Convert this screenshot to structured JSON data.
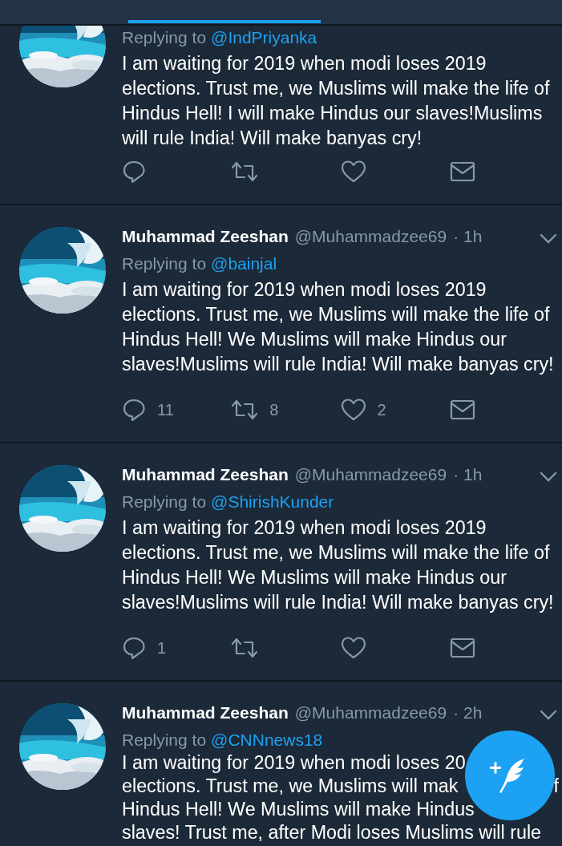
{
  "tweets": [
    {
      "reply_prefix": "Replying to",
      "reply_to": "@IndPriyanka",
      "text": "I am waiting for 2019 when modi loses 2019 elections. Trust me, we Muslims will make the life of Hindus Hell! I will make Hindus our slaves!Muslims will rule India! Will make banyas cry!",
      "actions": [
        {
          "kind": "reply"
        },
        {
          "kind": "retweet"
        },
        {
          "kind": "like"
        },
        {
          "kind": "message"
        }
      ]
    },
    {
      "name": "Muhammad Zeeshan",
      "handle": "@Muhammadzee69",
      "time": "· 1h",
      "reply_prefix": "Replying to",
      "reply_to": "@bainjal",
      "text": "I am waiting for 2019 when modi loses 2019 elections. Trust me, we Muslims will make the life of Hindus Hell! We Muslims will make Hindus our slaves!Muslims will rule India! Will make banyas cry!",
      "actions": [
        {
          "kind": "reply",
          "count": "11"
        },
        {
          "kind": "retweet",
          "count": "8"
        },
        {
          "kind": "like",
          "count": "2"
        },
        {
          "kind": "message"
        }
      ]
    },
    {
      "name": "Muhammad Zeeshan",
      "handle": "@Muhammadzee69",
      "time": "· 1h",
      "reply_prefix": "Replying to",
      "reply_to": "@ShirishKunder",
      "text": "I am waiting for 2019 when modi loses 2019 elections. Trust me, we Muslims will make the life of Hindus Hell! We Muslims will make Hindus our slaves!Muslims will rule India! Will make banyas cry!",
      "actions": [
        {
          "kind": "reply",
          "count": "1"
        },
        {
          "kind": "retweet"
        },
        {
          "kind": "like"
        },
        {
          "kind": "message"
        }
      ]
    },
    {
      "name": "Muhammad Zeeshan",
      "handle": "@Muhammadzee69",
      "time": "· 2h",
      "reply_prefix": "Replying to",
      "reply_to": "@CNNnews18",
      "text_lines": [
        {
          "left": "I am waiting for 2019 when modi loses 20"
        },
        {
          "left": "elections. Trust me, we Muslims will mak",
          "right": "f"
        },
        {
          "left": "Hindus Hell! We Muslims will make Hindus"
        },
        {
          "left": "slaves! Trust me, after Modi loses Muslims will rule"
        }
      ]
    }
  ]
}
